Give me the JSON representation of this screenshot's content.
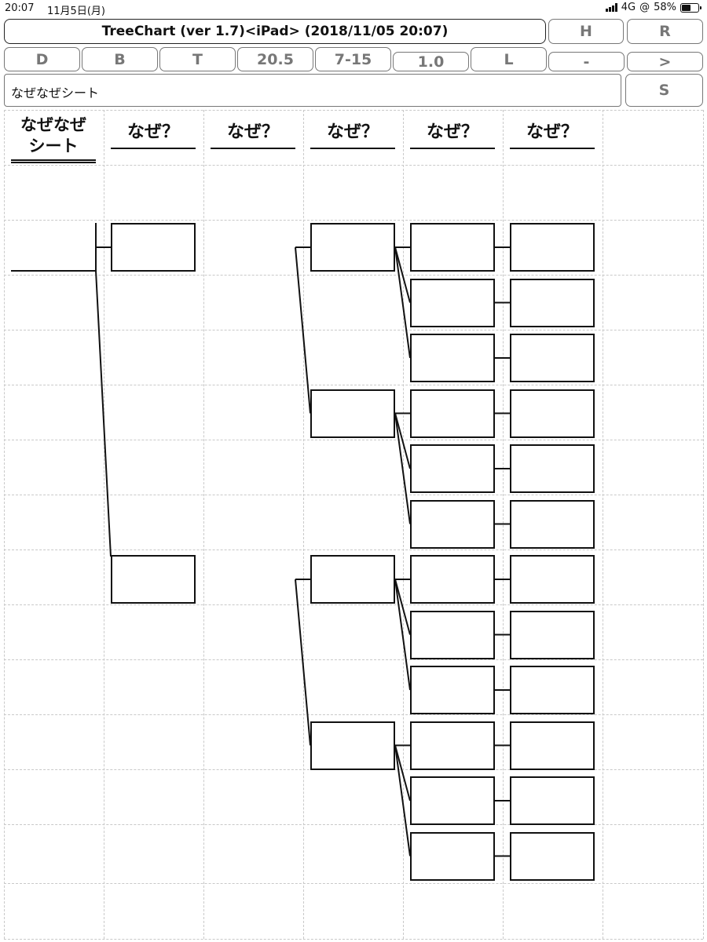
{
  "status": {
    "time": "20:07",
    "date": "11月5日(月)",
    "network": "4G",
    "battery_percent": "58%",
    "battery_level": 0.58
  },
  "toolbar": {
    "title": "TreeChart (ver 1.7)<iPad> (2018/11/05 20:07)",
    "h": "H",
    "r": "R",
    "d": "D",
    "b": "B",
    "t": "T",
    "font_size": "20.5",
    "range": "7-15",
    "line_width": "1.0",
    "l": "L",
    "minus": "-",
    "next": ">",
    "s": "S"
  },
  "sheet_title": "なぜなぜシート",
  "columns": {
    "first": [
      "なぜなぜ",
      "シート"
    ],
    "headers": [
      "なぜ？",
      "なぜ？",
      "なぜ？",
      "なぜ？",
      "なぜ？"
    ]
  },
  "tree": {
    "children_per_node": [
      2,
      2,
      3,
      1
    ],
    "leaf_count": 12
  }
}
